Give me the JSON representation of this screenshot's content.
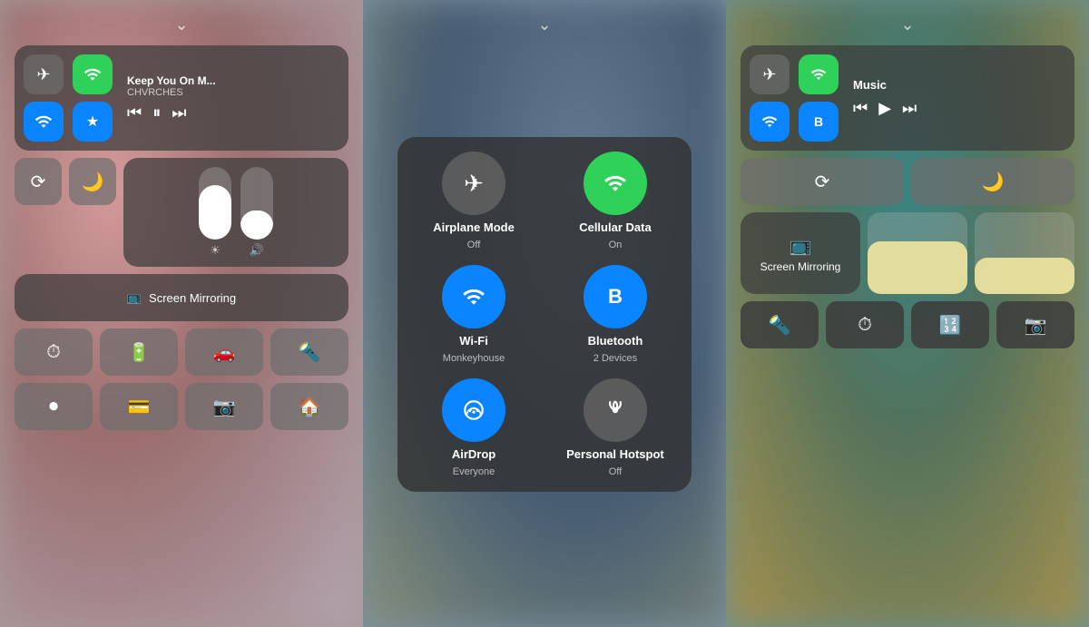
{
  "panel1": {
    "chevron": "chevron.down",
    "music": {
      "title": "Keep You On M...",
      "artist": "CHVRCHES"
    },
    "airplane_mode": {
      "state": "off"
    },
    "wifi": {
      "state": "on"
    },
    "bluetooth": {
      "state": "on"
    },
    "cellular": {
      "state": "on"
    },
    "screen_mirror": "Screen Mirroring",
    "buttons_row4": [
      "timer",
      "battery",
      "carplay",
      "flashlight"
    ],
    "buttons_row5": [
      "record",
      "wallet",
      "camera",
      "home"
    ]
  },
  "panel2": {
    "chevron": "chevron.down",
    "items": [
      {
        "id": "airplane",
        "label": "Airplane Mode",
        "sub": "Off",
        "state": "gray"
      },
      {
        "id": "cellular",
        "label": "Cellular Data",
        "sub": "On",
        "state": "green"
      },
      {
        "id": "wifi",
        "label": "Wi-Fi",
        "sub": "Monkeyhouse",
        "state": "blue"
      },
      {
        "id": "bluetooth",
        "label": "Bluetooth",
        "sub": "2 Devices",
        "state": "blue"
      },
      {
        "id": "airdrop",
        "label": "AirDrop",
        "sub": "Everyone",
        "state": "blue"
      },
      {
        "id": "hotspot",
        "label": "Personal Hotspot",
        "sub": "Off",
        "state": "gray"
      }
    ]
  },
  "panel3": {
    "chevron": "chevron.down",
    "music_title": "Music",
    "screen_mirror": "Screen Mirroring",
    "buttons_row4": [
      "flashlight",
      "timer",
      "calculator",
      "camera"
    ]
  }
}
